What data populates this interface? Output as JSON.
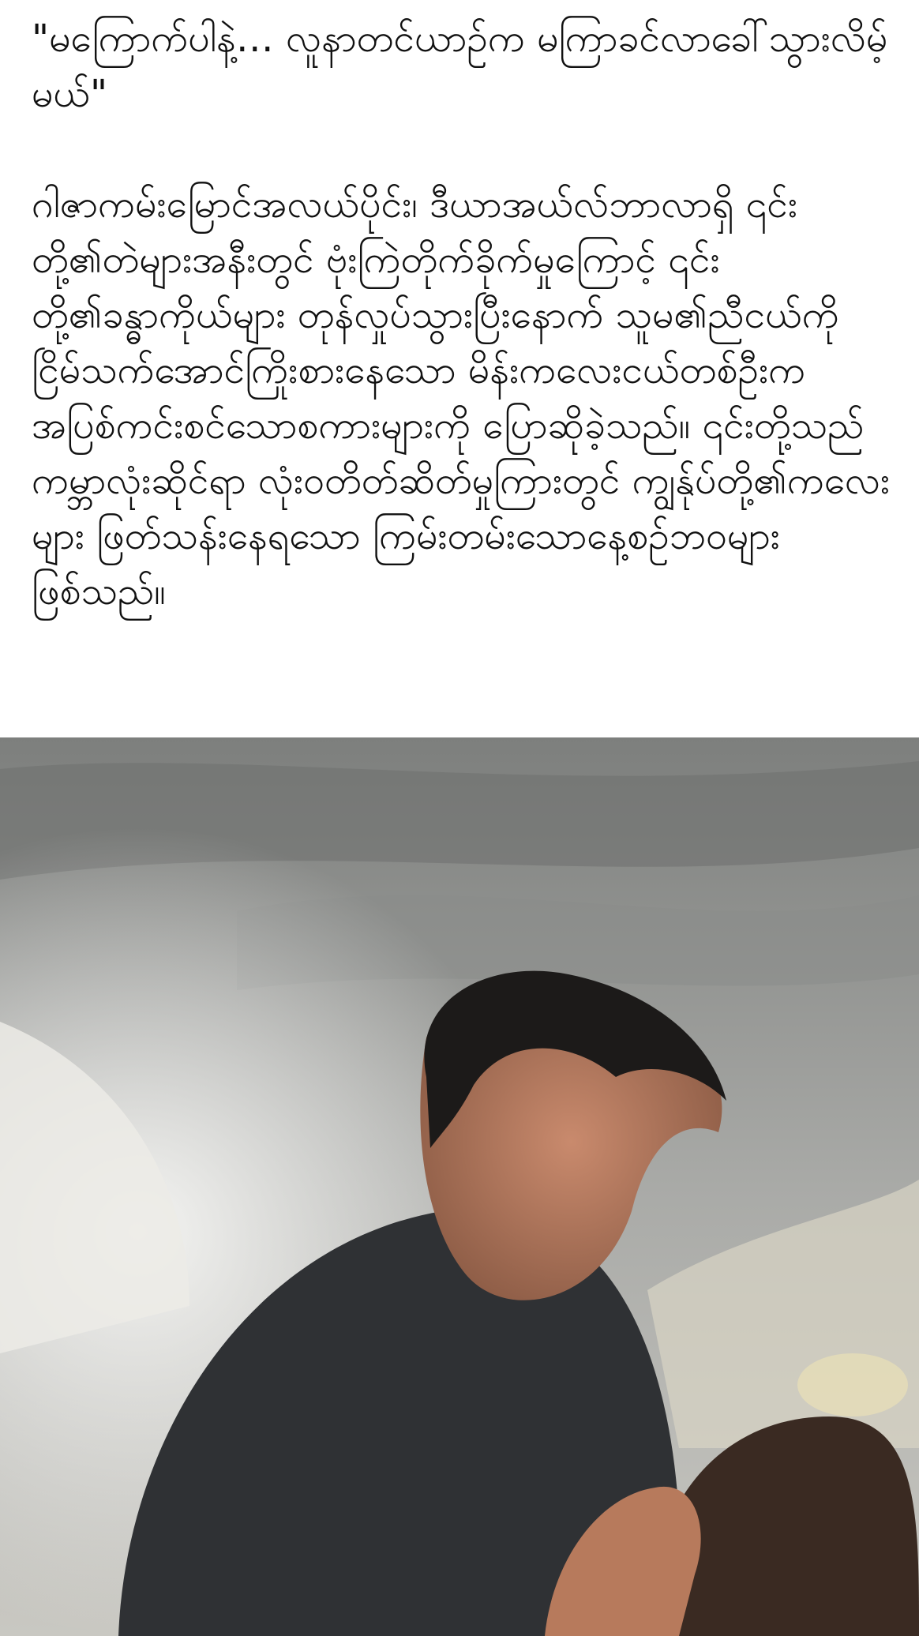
{
  "post": {
    "quote": "\"မကြောက်ပါနဲ့… လူနာတင်ယာဉ်က မကြာခင်လာခေါ်သွားလိမ့်မယ်\"",
    "body": "ဂါဇာကမ်းမြောင်အလယ်ပိုင်း၊ ဒီယာအယ်လ်ဘာလာရှိ ၎င်းတို့၏တဲများအနီးတွင် ဗုံးကြဲတိုက်ခိုက်မှုကြောင့် ၎င်းတို့၏ခန္ဓာကိုယ်များ တုန်လှုပ်သွားပြီးနောက် သူမ၏ညီငယ်ကို ငြိမ်သက်အောင်ကြိုးစားနေသော မိန်းကလေးငယ်တစ်ဦးက အပြစ်ကင်းစင်သောစကားများကို ပြောဆိုခဲ့သည်။ ၎င်းတို့သည် ကမ္ဘာလုံးဆိုင်ရာ လုံးဝတိတ်ဆိတ်မှုကြားတွင် ကျွန်ုပ်တို့၏ကလေးများ ဖြတ်သန်းနေရသော ကြမ်းတမ်းသောနေ့စဉ်ဘဝများဖြစ်သည်။"
  }
}
